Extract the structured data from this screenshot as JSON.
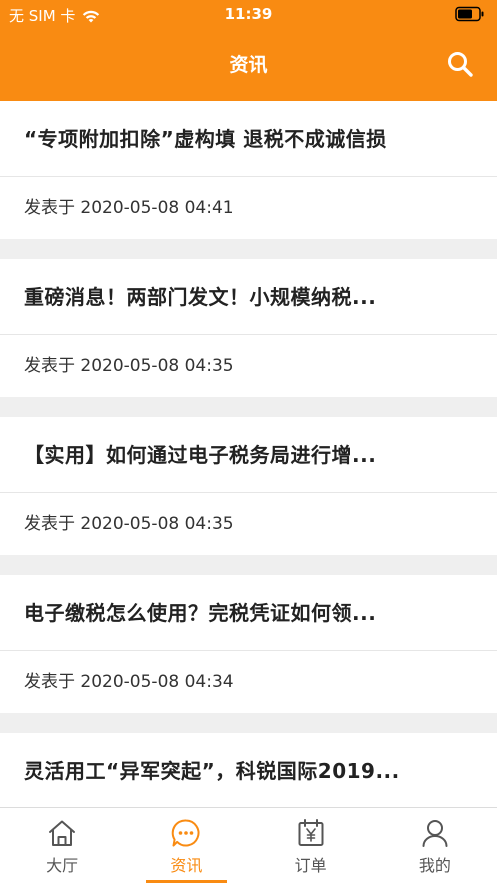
{
  "status_bar": {
    "carrier": "无 SIM 卡",
    "time": "11:39"
  },
  "nav": {
    "title": "资讯",
    "search_icon": "search-icon"
  },
  "colors": {
    "accent": "#f98b12",
    "background": "#efefef"
  },
  "articles": [
    {
      "title": "“专项附加扣除”虚构填 退税不成诚信损",
      "date": "发表于 2020-05-08 04:41"
    },
    {
      "title": "重磅消息！两部门发文！小规模纳税...",
      "date": "发表于 2020-05-08 04:35"
    },
    {
      "title": "【实用】如何通过电子税务局进行增...",
      "date": "发表于 2020-05-08 04:35"
    },
    {
      "title": "电子缴税怎么使用？完税凭证如何领...",
      "date": "发表于 2020-05-08 04:34"
    },
    {
      "title": "灵活用工“异军突起”，科锐国际2019...",
      "date": ""
    }
  ],
  "tabs": [
    {
      "label": "大厅",
      "icon": "home-icon",
      "active": false
    },
    {
      "label": "资讯",
      "icon": "chat-bubble-icon",
      "active": true
    },
    {
      "label": "订单",
      "icon": "calendar-yen-icon",
      "active": false
    },
    {
      "label": "我的",
      "icon": "person-icon",
      "active": false
    }
  ]
}
